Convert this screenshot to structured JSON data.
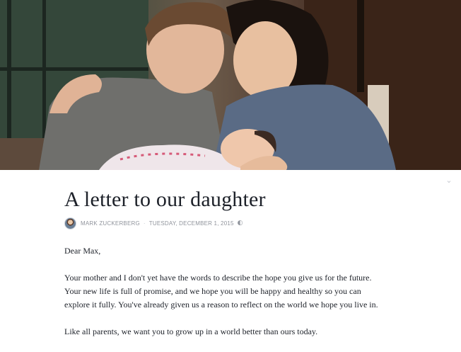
{
  "cover": {
    "alt": "Cover photo"
  },
  "article": {
    "title": "A letter to our daughter",
    "author": "MARK ZUCKERBERG",
    "date": "TUESDAY, DECEMBER 1, 2015",
    "privacy_icon": "globe-icon",
    "collapse_icon": "chevron-down-icon",
    "paragraphs": [
      "Dear Max,",
      "Your mother and I don't yet have the words to describe the hope you give us for the future.\nYour new life is full of promise, and we hope you will be happy and healthy so you can\nexplore it fully. You've already given us a reason to reflect on the world we hope you live in.",
      "Like all parents, we want you to grow up in a world better than ours today."
    ]
  },
  "colors": {
    "title": "#1d2129",
    "meta": "#90949c",
    "background": "#ffffff"
  }
}
